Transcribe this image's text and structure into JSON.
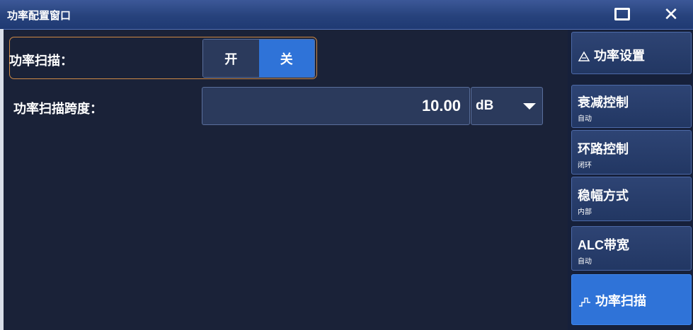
{
  "window": {
    "title": "功率配置窗口"
  },
  "power_sweep": {
    "label": "功率扫描：",
    "toggle": {
      "on_label": "开",
      "off_label": "关",
      "selected": "关"
    }
  },
  "sweep_span": {
    "label": "功率扫描跨度：",
    "value": "10.00",
    "unit": "dB"
  },
  "menu": {
    "header": "功率设置",
    "items": [
      {
        "label": "衰减控制",
        "sub": "自动"
      },
      {
        "label": "环路控制",
        "sub": "闭环"
      },
      {
        "label": "稳幅方式",
        "sub": "内部"
      },
      {
        "label": "ALC带宽",
        "sub": "自动"
      }
    ],
    "active": "功率扫描"
  },
  "colors": {
    "background": "#1a2238",
    "titlebar": "#27427c",
    "selected_blue": "#2f73d8",
    "focus_border": "#cf8a45"
  }
}
